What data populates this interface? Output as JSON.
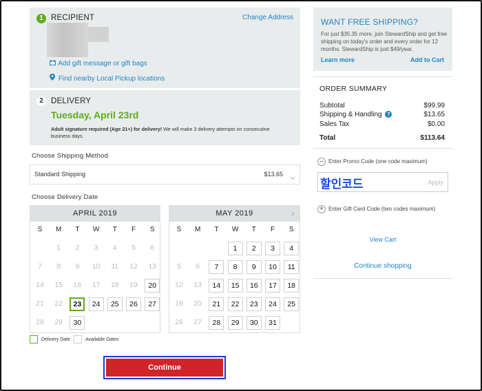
{
  "recipient": {
    "step": "1",
    "title": "RECIPIENT",
    "change_address": "Change Address",
    "gift_message": "Add gift message or gift bags",
    "pickup": "Find nearby Local Pickup locations"
  },
  "delivery": {
    "step": "2",
    "title": "DELIVERY",
    "date": "Tuesday, April 23rd",
    "note_bold": "Adult signature required (Age 21+) for delivery!",
    "note_rest": " We will make 3 delivery attempts on consecutive business days."
  },
  "shipping": {
    "label": "Choose Shipping Method",
    "method": "Standard Shipping",
    "price": "$13.65"
  },
  "delivery_date": {
    "label": "Choose Delivery Date",
    "weekdays": [
      "S",
      "M",
      "T",
      "W",
      "T",
      "F",
      "S"
    ],
    "april": {
      "title": "APRIL 2019",
      "rows": [
        [
          "1",
          "2",
          "3",
          "4",
          "5",
          "6"
        ],
        [
          "7",
          "8",
          "9",
          "10",
          "11",
          "12",
          "13"
        ],
        [
          "14",
          "15",
          "16",
          "17",
          "18",
          "19",
          "20"
        ],
        [
          "21",
          "22",
          "23",
          "24",
          "25",
          "26",
          "27"
        ],
        [
          "28",
          "29",
          "30"
        ]
      ]
    },
    "may": {
      "title": "MAY 2019",
      "next": "›",
      "rows": [
        [
          "1",
          "2",
          "3",
          "4"
        ],
        [
          "5",
          "6",
          "7",
          "8",
          "9",
          "10",
          "11"
        ],
        [
          "12",
          "13",
          "14",
          "15",
          "16",
          "17",
          "18"
        ],
        [
          "19",
          "20",
          "21",
          "22",
          "23",
          "24",
          "25"
        ],
        [
          "26",
          "27",
          "28",
          "29",
          "30",
          "31"
        ]
      ]
    },
    "legend_delivery": "Delivery Date",
    "legend_available": "Available Dates"
  },
  "continue_label": "Continue",
  "shipping_promo": {
    "title": "WANT FREE SHIPPING?",
    "text": "For just $35.35 more, join StewardShip and get free shipping on today's order and every order for 12 months. StewardShip is just $49/year.",
    "learn_more": "Learn more",
    "add_to_cart": "Add to Cart"
  },
  "summary": {
    "title": "ORDER SUMMARY",
    "subtotal_label": "Subtotal",
    "subtotal": "$99.99",
    "shipping_label": "Shipping & Handling",
    "shipping": "$13.65",
    "tax_label": "Sales Tax",
    "tax": "$0.00",
    "total_label": "Total",
    "total": "$113.64"
  },
  "promo": {
    "toggle": "Enter Promo Code (one code maximum)",
    "value": "할인코드",
    "apply": "Apply",
    "gift_card": "Enter Gift Card Code (two codes maximum)"
  },
  "view_cart": "View Cart",
  "continue_shopping": "Continue shopping",
  "colors": {
    "green": "#5cad1f",
    "link": "#1f84c6",
    "red": "#d1232a",
    "highlight_border": "#1a3bd6"
  }
}
